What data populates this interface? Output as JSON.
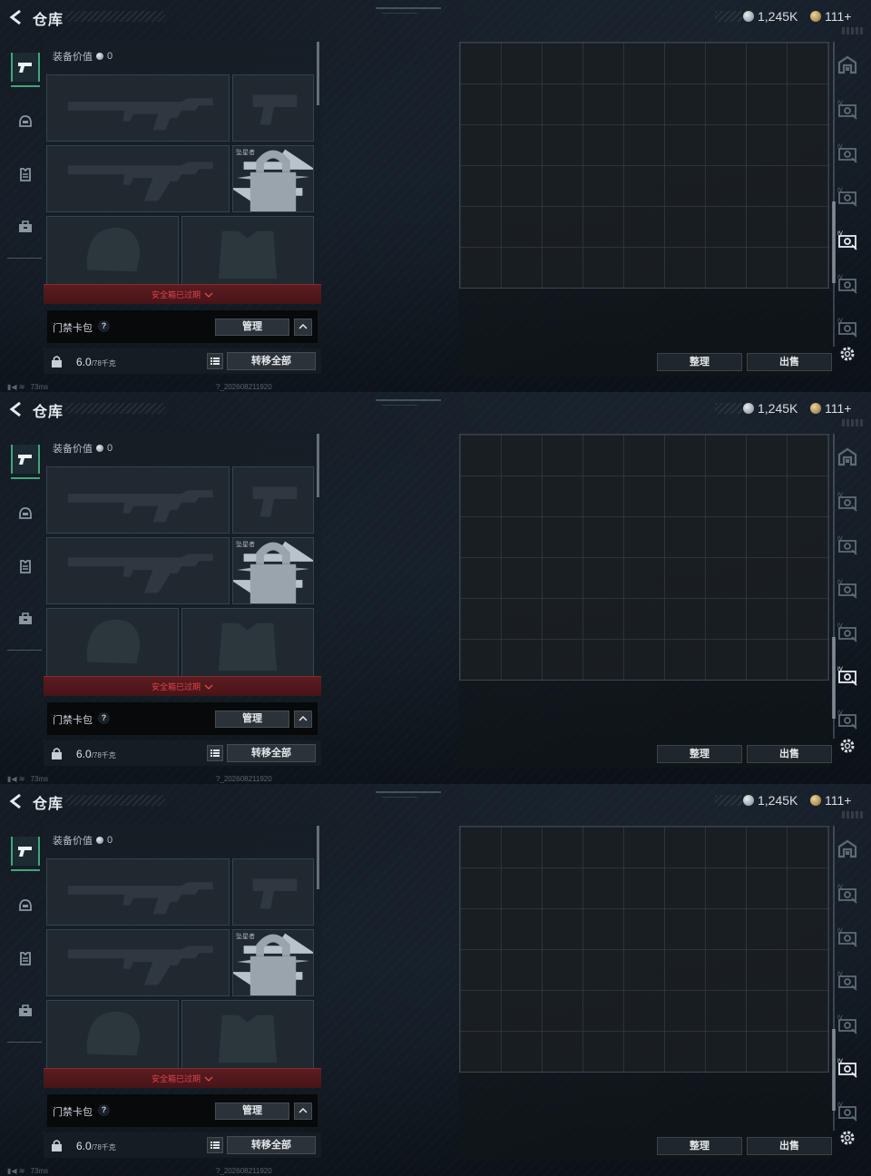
{
  "frames": [
    {
      "header": {
        "title": "仓库"
      },
      "currency": {
        "silver_amount": "1,245K",
        "gold_amount": "111+"
      },
      "left_tabs": [
        {
          "icon": "pistol-icon",
          "active": true
        },
        {
          "icon": "helmet-icon",
          "active": false
        },
        {
          "icon": "vest-icon",
          "active": false
        },
        {
          "icon": "toolbox-icon",
          "active": false
        }
      ],
      "equipment": {
        "value_label": "装备价值",
        "value": "0",
        "melee_name": "坠星者"
      },
      "safebox": {
        "label": "安全箱已过期"
      },
      "keycard": {
        "label": "门禁卡包",
        "help": "?",
        "manage_button": "管理"
      },
      "capacity": {
        "current": "6.0",
        "max": "/78千克",
        "transfer_button": "转移全部"
      },
      "storage": {
        "sort_button": "整理",
        "sell_button": "出售"
      },
      "right_icons": [
        "warehouse-icon",
        "storage-tab-1-icon",
        "storage-tab-2-icon",
        "storage-tab-3-icon",
        "storage-tab-4-icon",
        "storage-tab-5-icon",
        "storage-tab-6-icon"
      ],
      "active_storage_tab": 4,
      "status": {
        "ping": "73ms",
        "build": "?_202608211920"
      }
    },
    {
      "header": {
        "title": "仓库"
      },
      "currency": {
        "silver_amount": "1,245K",
        "gold_amount": "111+"
      },
      "left_tabs": [
        {
          "icon": "pistol-icon",
          "active": true
        },
        {
          "icon": "helmet-icon",
          "active": false
        },
        {
          "icon": "vest-icon",
          "active": false
        },
        {
          "icon": "toolbox-icon",
          "active": false
        }
      ],
      "equipment": {
        "value_label": "装备价值",
        "value": "0",
        "melee_name": "坠星者"
      },
      "safebox": {
        "label": "安全箱已过期"
      },
      "keycard": {
        "label": "门禁卡包",
        "help": "?",
        "manage_button": "管理"
      },
      "capacity": {
        "current": "6.0",
        "max": "/78千克",
        "transfer_button": "转移全部"
      },
      "storage": {
        "sort_button": "整理",
        "sell_button": "出售"
      },
      "right_icons": [
        "warehouse-icon",
        "storage-tab-1-icon",
        "storage-tab-2-icon",
        "storage-tab-3-icon",
        "storage-tab-4-icon",
        "storage-tab-5-icon",
        "storage-tab-6-icon"
      ],
      "active_storage_tab": 5,
      "status": {
        "ping": "73ms",
        "build": "?_202608211920"
      }
    },
    {
      "header": {
        "title": "仓库"
      },
      "currency": {
        "silver_amount": "1,245K",
        "gold_amount": "111+"
      },
      "left_tabs": [
        {
          "icon": "pistol-icon",
          "active": true
        },
        {
          "icon": "helmet-icon",
          "active": false
        },
        {
          "icon": "vest-icon",
          "active": false
        },
        {
          "icon": "toolbox-icon",
          "active": false
        }
      ],
      "equipment": {
        "value_label": "装备价值",
        "value": "0",
        "melee_name": "坠星者"
      },
      "safebox": {
        "label": "安全箱已过期"
      },
      "keycard": {
        "label": "门禁卡包",
        "help": "?",
        "manage_button": "管理"
      },
      "capacity": {
        "current": "6.0",
        "max": "/78千克",
        "transfer_button": "转移全部"
      },
      "storage": {
        "sort_button": "整理",
        "sell_button": "出售"
      },
      "right_icons": [
        "warehouse-icon",
        "storage-tab-1-icon",
        "storage-tab-2-icon",
        "storage-tab-3-icon",
        "storage-tab-4-icon",
        "storage-tab-5-icon",
        "storage-tab-6-icon"
      ],
      "active_storage_tab": 5,
      "status": {
        "ping": "73ms",
        "build": "?_202608211920"
      }
    }
  ]
}
